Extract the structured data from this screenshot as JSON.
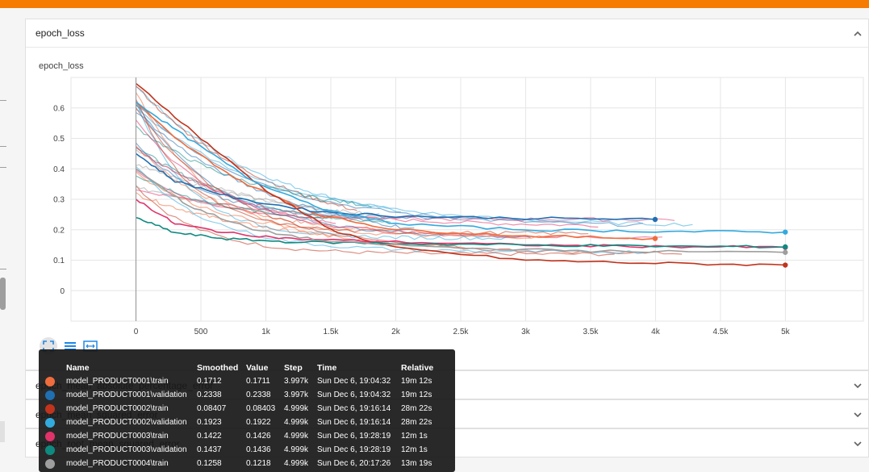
{
  "colors": {
    "accent": "#f57c00",
    "series": [
      "#ef6c3d",
      "#1f6fb2",
      "#c0341d",
      "#33aadd",
      "#e0336a",
      "#0f8a80",
      "#9e9e9e"
    ]
  },
  "main_card": {
    "title": "epoch_loss",
    "chart_title": "epoch_loss",
    "toggle_icon": "chevron-up-icon"
  },
  "toolbar": {
    "icons": [
      "expand-icon",
      "list-icon",
      "fit-domain-icon"
    ]
  },
  "collapsed_cards": [
    {
      "title": "epoch_mean_absolute_percentage_error",
      "toggle_icon": "chevron-down-icon"
    },
    {
      "title": "epoch_mean_squared_error",
      "toggle_icon": "chevron-down-icon"
    },
    {
      "title": "epoch_root_mean_squared_error",
      "toggle_icon": "chevron-down-icon"
    }
  ],
  "chart_data": {
    "type": "line",
    "title": "",
    "xlabel": "",
    "ylabel": "",
    "xlim": [
      -500,
      5600
    ],
    "ylim": [
      -0.1,
      0.7
    ],
    "x_ticks": [
      "0",
      "500",
      "1k",
      "1.5k",
      "2k",
      "2.5k",
      "3k",
      "3.5k",
      "4k",
      "4.5k",
      "5k"
    ],
    "x_tick_values": [
      0,
      500,
      1000,
      1500,
      2000,
      2500,
      3000,
      3500,
      4000,
      4500,
      5000
    ],
    "y_ticks": [
      "0",
      "0.1",
      "0.2",
      "0.3",
      "0.4",
      "0.5",
      "0.6"
    ],
    "y_tick_values": [
      0,
      0.1,
      0.2,
      0.3,
      0.4,
      0.5,
      0.6
    ],
    "grid": true,
    "series": [
      {
        "name": "model_PRODUCT0001\\train",
        "color": "#ef6c3d",
        "x": [
          0,
          300,
          800,
          1400,
          2000,
          3000,
          3997
        ],
        "y": [
          0.62,
          0.5,
          0.36,
          0.25,
          0.2,
          0.18,
          0.1712
        ]
      },
      {
        "name": "model_PRODUCT0001\\validation",
        "color": "#1f6fb2",
        "x": [
          0,
          300,
          800,
          1400,
          2000,
          3000,
          3997
        ],
        "y": [
          0.45,
          0.36,
          0.3,
          0.26,
          0.245,
          0.238,
          0.2338
        ]
      },
      {
        "name": "model_PRODUCT0002\\train",
        "color": "#c0341d",
        "x": [
          0,
          500,
          1000,
          1500,
          2000,
          3000,
          4000,
          4999
        ],
        "y": [
          0.68,
          0.5,
          0.33,
          0.2,
          0.14,
          0.1,
          0.09,
          0.08407
        ]
      },
      {
        "name": "model_PRODUCT0002\\validation",
        "color": "#33aadd",
        "x": [
          0,
          400,
          900,
          1500,
          2000,
          3000,
          4000,
          4999
        ],
        "y": [
          0.62,
          0.5,
          0.36,
          0.26,
          0.22,
          0.2,
          0.195,
          0.1923
        ]
      },
      {
        "name": "model_PRODUCT0003\\train",
        "color": "#e0336a",
        "x": [
          0,
          300,
          700,
          1200,
          2000,
          3000,
          4000,
          4999
        ],
        "y": [
          0.3,
          0.22,
          0.19,
          0.17,
          0.16,
          0.15,
          0.145,
          0.1422
        ]
      },
      {
        "name": "model_PRODUCT0003\\validation",
        "color": "#0f8a80",
        "x": [
          0,
          300,
          700,
          1200,
          2000,
          3000,
          4000,
          4999
        ],
        "y": [
          0.24,
          0.19,
          0.17,
          0.16,
          0.155,
          0.15,
          0.146,
          0.1437
        ]
      },
      {
        "name": "model_PRODUCT0004\\train",
        "color": "#9e9e9e",
        "x": [
          0,
          400,
          900,
          1500,
          2500,
          3500,
          4999
        ],
        "y": [
          0.4,
          0.28,
          0.2,
          0.16,
          0.14,
          0.13,
          0.1258
        ]
      }
    ]
  },
  "tooltip": {
    "headers": [
      "Name",
      "Smoothed",
      "Value",
      "Step",
      "Time",
      "Relative"
    ],
    "rows": [
      {
        "color": "#ef6c3d",
        "name": "model_PRODUCT0001\\train",
        "smoothed": "0.1712",
        "value": "0.1711",
        "step": "3.997k",
        "time": "Sun Dec 6, 19:04:32",
        "relative": "19m 12s"
      },
      {
        "color": "#1f6fb2",
        "name": "model_PRODUCT0001\\validation",
        "smoothed": "0.2338",
        "value": "0.2338",
        "step": "3.997k",
        "time": "Sun Dec 6, 19:04:32",
        "relative": "19m 12s"
      },
      {
        "color": "#c0341d",
        "name": "model_PRODUCT0002\\train",
        "smoothed": "0.08407",
        "value": "0.08403",
        "step": "4.999k",
        "time": "Sun Dec 6, 19:16:14",
        "relative": "28m 22s"
      },
      {
        "color": "#33aadd",
        "name": "model_PRODUCT0002\\validation",
        "smoothed": "0.1923",
        "value": "0.1922",
        "step": "4.999k",
        "time": "Sun Dec 6, 19:16:14",
        "relative": "28m 22s"
      },
      {
        "color": "#e0336a",
        "name": "model_PRODUCT0003\\train",
        "smoothed": "0.1422",
        "value": "0.1426",
        "step": "4.999k",
        "time": "Sun Dec 6, 19:28:19",
        "relative": "12m 1s"
      },
      {
        "color": "#0f8a80",
        "name": "model_PRODUCT0003\\validation",
        "smoothed": "0.1437",
        "value": "0.1436",
        "step": "4.999k",
        "time": "Sun Dec 6, 19:28:19",
        "relative": "12m 1s"
      },
      {
        "color": "#9e9e9e",
        "name": "model_PRODUCT0004\\train",
        "smoothed": "0.1258",
        "value": "0.1218",
        "step": "4.999k",
        "time": "Sun Dec 6, 20:17:26",
        "relative": "13m 19s"
      }
    ]
  }
}
